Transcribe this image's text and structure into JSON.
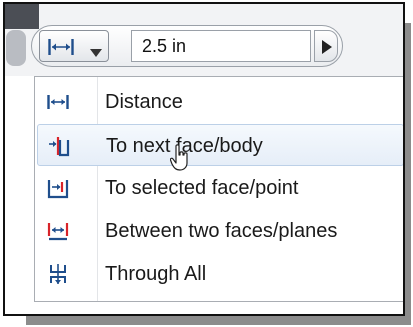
{
  "toolbar": {
    "extents_button": {
      "icon": "distance-extent-icon"
    },
    "distance_value": "2.5 in",
    "flip_direction_icon": "play-right-icon"
  },
  "extents_menu": {
    "items": [
      {
        "label": "Distance",
        "icon": "distance-extent-icon"
      },
      {
        "label": "To next face/body",
        "icon": "to-next-icon",
        "hovered": true
      },
      {
        "label": "To selected face/point",
        "icon": "to-selected-icon"
      },
      {
        "label": "Between two faces/planes",
        "icon": "between-icon"
      },
      {
        "label": "Through All",
        "icon": "through-all-icon"
      }
    ]
  },
  "colors": {
    "icon_blue": "#1f4e8c",
    "icon_red": "#d8242a",
    "hover_fill": "#e6eef8",
    "hover_border": "#bcd0e7"
  }
}
